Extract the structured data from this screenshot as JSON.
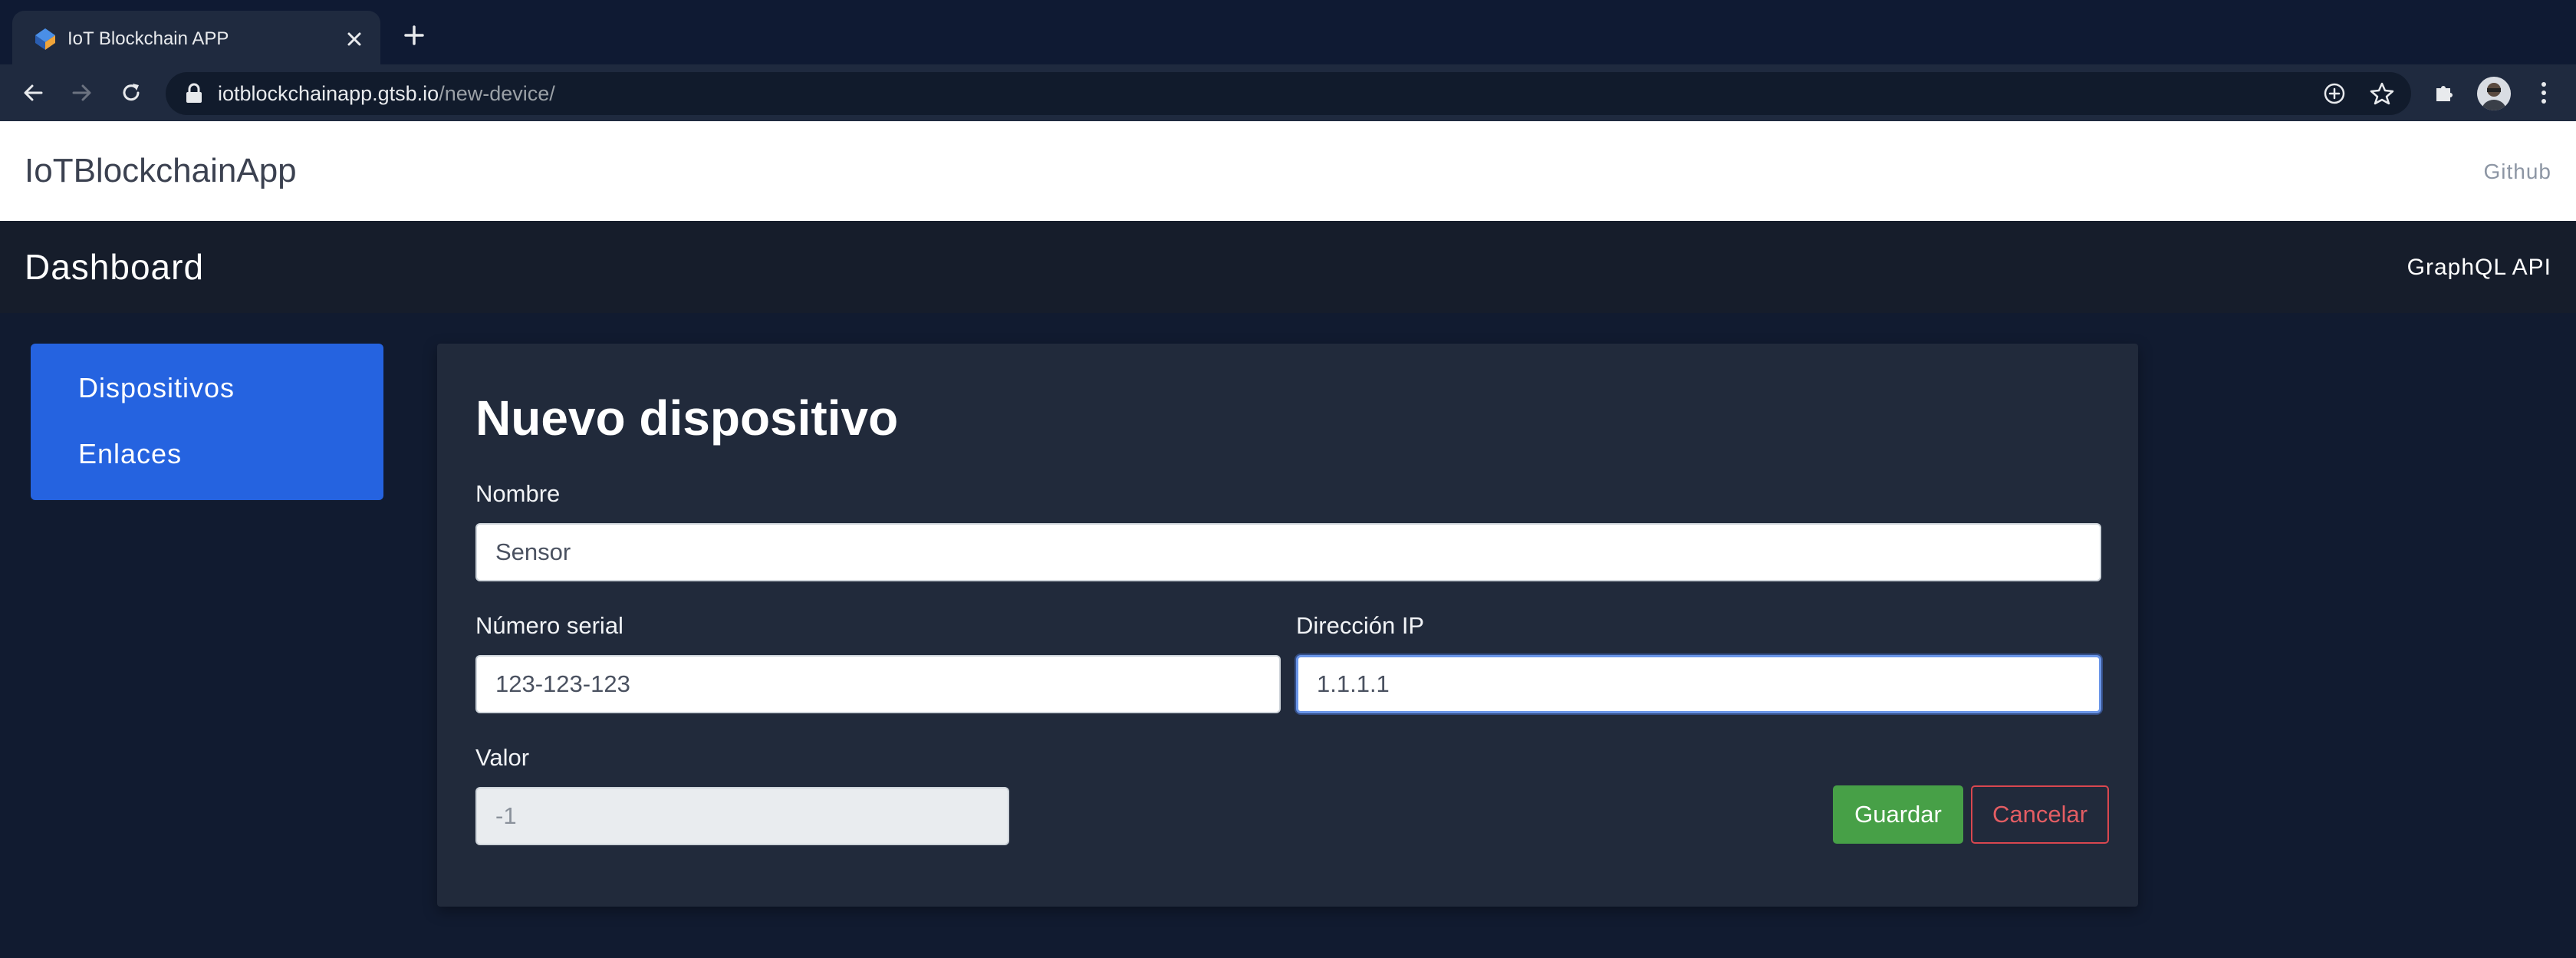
{
  "browser": {
    "tab_title": "IoT Blockchain APP",
    "url_host": "iotblockchainapp.gtsb.io",
    "url_path": "/new-device/"
  },
  "header": {
    "brand": "IoTBlockchainApp",
    "github": "Github"
  },
  "dashboard": {
    "title": "Dashboard",
    "graphql": "GraphQL API"
  },
  "sidebar": {
    "items": [
      {
        "label": "Dispositivos"
      },
      {
        "label": "Enlaces"
      }
    ]
  },
  "form": {
    "title": "Nuevo dispositivo",
    "name_label": "Nombre",
    "name_value": "Sensor",
    "serial_label": "Número serial",
    "serial_value": "123-123-123",
    "ip_label": "Dirección IP",
    "ip_value": "1.1.1.1",
    "value_label": "Valor",
    "value_value": "-1",
    "save_label": "Guardar",
    "cancel_label": "Cancelar"
  },
  "colors": {
    "page_bg": "#111b30",
    "sidebar_bg": "#2563e0",
    "card_bg": "#212a3b",
    "save_button": "#47a047",
    "cancel_button": "#d9474f"
  }
}
